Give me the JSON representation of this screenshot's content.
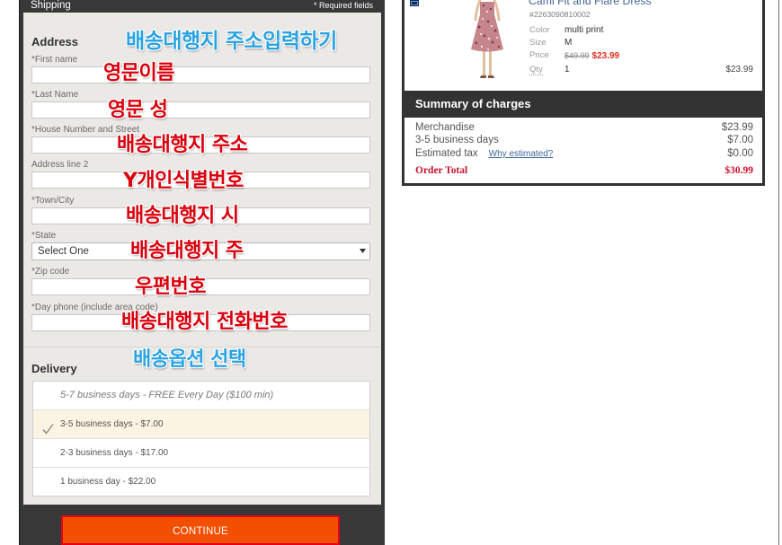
{
  "colors": {
    "annotation_red": "#d9000d",
    "annotation_blue": "#2aa3e2",
    "panel_dark": "#383838",
    "button_orange": "#f24f00",
    "selected_row": "#fbf4e3",
    "sale_red": "#e0301e",
    "total_red": "#c8102e",
    "link_blue": "#3f6796"
  },
  "icons": {
    "state_select": "caret-down-icon",
    "selected_delivery": "check-icon",
    "brand": "brand-logo"
  },
  "shipping": {
    "title": "Shipping",
    "required_note": "* Required fields",
    "address_heading": "Address",
    "fields": [
      {
        "label": "*First name",
        "value": ""
      },
      {
        "label": "*Last Name",
        "value": ""
      },
      {
        "label": "*House Number and Street",
        "value": ""
      },
      {
        "label": "Address line 2",
        "value": ""
      },
      {
        "label": "*Town/City",
        "value": ""
      },
      {
        "label": "*State",
        "value": "Select One"
      },
      {
        "label": "*Zip code",
        "value": ""
      },
      {
        "label": "*Day phone (include area code)",
        "value": ""
      }
    ],
    "delivery_heading": "Delivery",
    "delivery_options": [
      {
        "label": "5-7 business days - FREE Every Day ($100 min)",
        "available": false,
        "selected": false
      },
      {
        "label": "3-5 business days - $7.00",
        "available": true,
        "selected": true
      },
      {
        "label": "2-3 business days - $17.00",
        "available": true,
        "selected": false
      },
      {
        "label": "1 business day - $22.00",
        "available": true,
        "selected": false
      }
    ],
    "continue_label": "CONTINUE"
  },
  "annotations": [
    {
      "text": "배송대행지 주소입력하기",
      "color": "blue"
    },
    {
      "text": "영문이름",
      "color": "red"
    },
    {
      "text": "영문 성",
      "color": "red"
    },
    {
      "text": "배송대행지 주소",
      "color": "red"
    },
    {
      "text": "Y개인식별번호",
      "color": "red"
    },
    {
      "text": "배송대행지 시",
      "color": "red"
    },
    {
      "text": "배송대행지 주",
      "color": "red"
    },
    {
      "text": "우편번호",
      "color": "red"
    },
    {
      "text": "배송대행지 전화번호",
      "color": "red"
    },
    {
      "text": "배송옵션 선택",
      "color": "blue"
    }
  ],
  "product": {
    "name": "Cami Fit and Flare Dress",
    "sku": "#2263090810002",
    "color_label": "Color",
    "color_value": "multi print",
    "size_label": "Size",
    "size_value": "M",
    "price_label": "Price",
    "original_price": "$49.99",
    "sale_price": "$23.99",
    "qty_label": "Qty",
    "qty": "1",
    "line_total": "$23.99"
  },
  "summary": {
    "title": "Summary of charges",
    "rows": [
      {
        "label": "Merchandise",
        "value": "$23.99"
      },
      {
        "label": "3-5 business days",
        "value": "$7.00"
      },
      {
        "label": "Estimated tax",
        "link": "Why estimated?",
        "value": "$0.00"
      }
    ],
    "total_label": "Order Total",
    "total_value": "$30.99"
  }
}
